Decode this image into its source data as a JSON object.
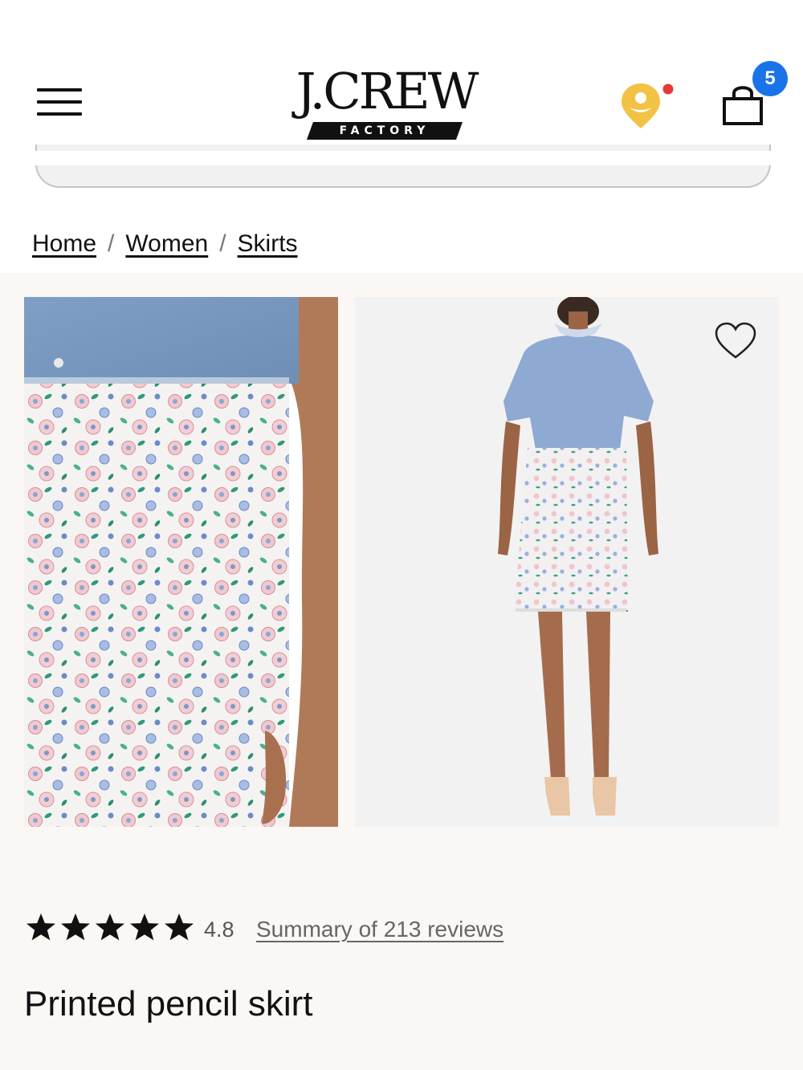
{
  "header": {
    "logo_text": "J.CREW",
    "logo_subtext": "FACTORY",
    "bag_count": "5",
    "icons": {
      "menu": "hamburger-menu-icon",
      "rewards": "rewards-profile-icon",
      "bag": "shopping-bag-icon"
    }
  },
  "breadcrumb": {
    "items": [
      "Home",
      "Women",
      "Skirts"
    ],
    "separator": "/"
  },
  "product": {
    "rating_value": "4.8",
    "reviews_link": "Summary of 213 reviews",
    "name": "Printed pencil skirt",
    "wishlist_icon": "heart-icon"
  },
  "colors": {
    "badge": "#1a73e8",
    "rewards_icon": "#f3c245",
    "notification_dot": "#e53935",
    "product_bg": "#faf7f5"
  }
}
